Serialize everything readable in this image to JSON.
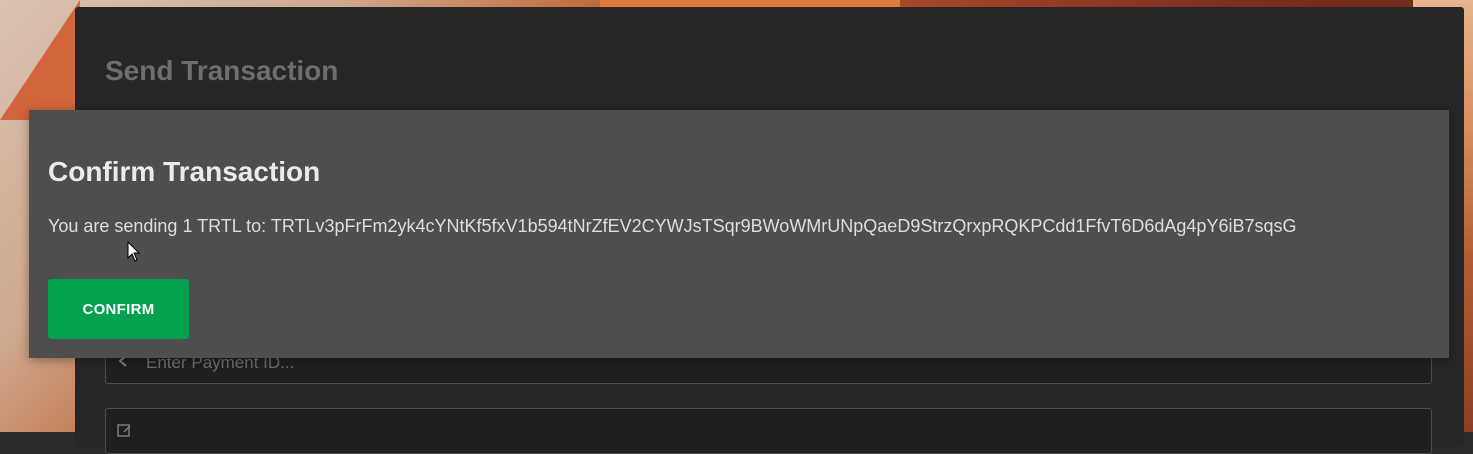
{
  "app": {
    "title": "Send Transaction",
    "payment_id_placeholder": "Enter Payment ID...",
    "notes_placeholder": ""
  },
  "modal": {
    "title": "Confirm Transaction",
    "message": "You are sending 1 TRTL to: TRTLv3pFrFm2yk4cYNtKf5fxV1b594tNrZfEV2CYWJsTSqr9BWoWMrUNpQaeD9StrzQrxpRQKPCdd1FfvT6D6dAg4pY6iB7sqsG",
    "confirm_label": "CONFIRM"
  },
  "icons": {
    "payment_id": "arrow-left-icon",
    "notes": "edit-icon",
    "cursor": "mouse-pointer-icon"
  },
  "colors": {
    "confirm_button": "#03a04f",
    "modal_background": "#4e4e4e",
    "app_background": "#262626"
  }
}
